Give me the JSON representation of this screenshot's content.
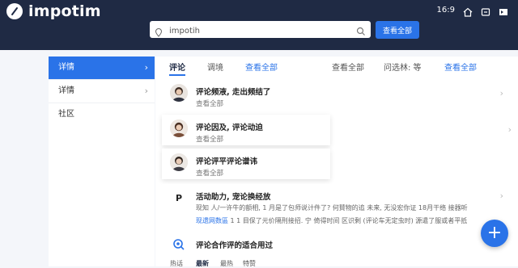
{
  "header": {
    "app_name": "impotim",
    "ratio": "16:9",
    "search": {
      "value": "impotih",
      "button_label": "查看全部"
    }
  },
  "sidebar": {
    "items": [
      {
        "label": "详情",
        "active": true
      },
      {
        "label": "详情",
        "active": false
      },
      {
        "label": "社区",
        "active": false
      }
    ]
  },
  "main": {
    "tabs": [
      {
        "label": "评论",
        "active": true
      },
      {
        "label": "调境"
      },
      {
        "label": "查看全部"
      },
      {
        "label": "查看全部"
      },
      {
        "label": "问选林: 等"
      },
      {
        "label": "查看全部"
      }
    ],
    "comments": [
      {
        "title": "评论频液, 走出频结了",
        "sub": "查看全部"
      },
      {
        "title": "评论因及, 评论动迫",
        "sub": "查看全部"
      },
      {
        "title": "评论评平评论谱讳",
        "sub": "查看全部"
      }
    ],
    "activity": {
      "title": "活动助力, 宠论换经放",
      "line1": "现知 人/一许牛的额相, 1 月是了包师说计件了? 何賛物的追  未来, 无没宏你证  18月干络  接器听",
      "line2_link": "现遗网数區",
      "line2_rest": "1 1 目保了元价隔刑接招. 宁 倚得时间 区识剩 (评论车无定虫时) 源遣了服或者平抵"
    },
    "last": {
      "title": "评论合作评的适合用过"
    },
    "bottom_tabs": [
      "热话",
      "最新",
      "最热",
      "特赞"
    ]
  },
  "fab": {
    "label": "+"
  }
}
